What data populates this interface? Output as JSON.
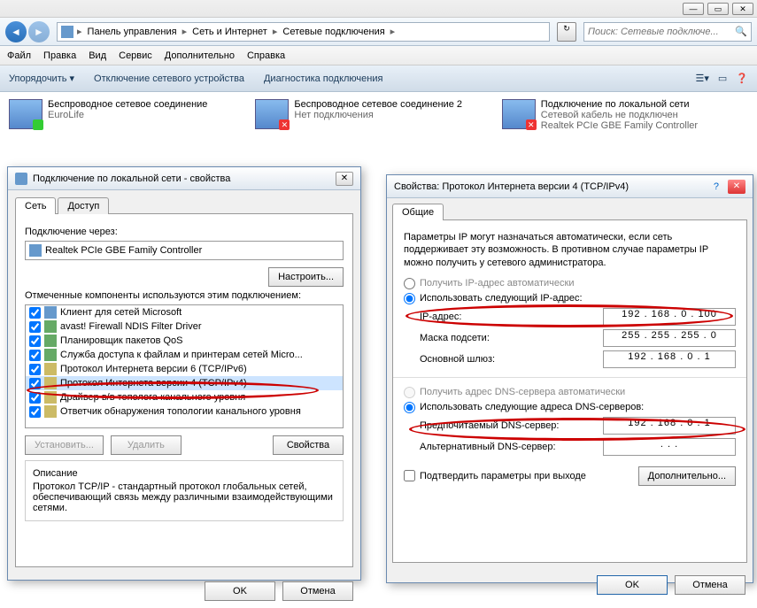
{
  "window": {
    "min": "—",
    "max": "▭",
    "close": "✕"
  },
  "breadcrumb": {
    "icon": "🖥",
    "items": [
      "Панель управления",
      "Сеть и Интернет",
      "Сетевые подключения"
    ],
    "sep": "▸"
  },
  "search": {
    "placeholder": "Поиск: Сетевые подключе..."
  },
  "menu": {
    "file": "Файл",
    "edit": "Правка",
    "view": "Вид",
    "service": "Сервис",
    "extra": "Дополнительно",
    "help": "Справка"
  },
  "toolbar": {
    "organize": "Упорядочить ▾",
    "disable": "Отключение сетевого устройства",
    "diag": "Диагностика подключения"
  },
  "adapters": [
    {
      "name": "Беспроводное сетевое соединение",
      "sub": "EuroLife",
      "third": ""
    },
    {
      "name": "Беспроводное сетевое соединение 2",
      "sub": "Нет подключения",
      "third": ""
    },
    {
      "name": "Подключение по локальной сети",
      "sub": "Сетевой кабель не подключен",
      "third": "Realtek PCIe GBE Family Controller"
    }
  ],
  "dlg1": {
    "title": "Подключение по локальной сети - свойства",
    "tab_net": "Сеть",
    "tab_access": "Доступ",
    "conn_via": "Подключение через:",
    "adapter": "Realtek PCIe GBE Family Controller",
    "configure": "Настроить...",
    "components_lbl": "Отмеченные компоненты используются этим подключением:",
    "components": [
      {
        "c": true,
        "t": "Клиент для сетей Microsoft"
      },
      {
        "c": true,
        "t": "avast! Firewall NDIS Filter Driver"
      },
      {
        "c": true,
        "t": "Планировщик пакетов QoS"
      },
      {
        "c": true,
        "t": "Служба доступа к файлам и принтерам сетей Micro..."
      },
      {
        "c": true,
        "t": "Протокол Интернета версии 6 (TCP/IPv6)"
      },
      {
        "c": true,
        "t": "Протокол Интернета версии 4 (TCP/IPv4)"
      },
      {
        "c": true,
        "t": "Драйвер в/в тополога канального уровня"
      },
      {
        "c": true,
        "t": "Ответчик обнаружения топологии канального уровня"
      }
    ],
    "install": "Установить...",
    "remove": "Удалить",
    "props": "Свойства",
    "desc_h": "Описание",
    "desc": "Протокол TCP/IP - стандартный протокол глобальных сетей, обеспечивающий связь между различными взаимодействующими сетями.",
    "ok": "OK",
    "cancel": "Отмена"
  },
  "dlg2": {
    "title": "Свойства: Протокол Интернета версии 4 (TCP/IPv4)",
    "tab_general": "Общие",
    "desc": "Параметры IP могут назначаться автоматически, если сеть поддерживает эту возможность. В противном случае параметры IP можно получить у сетевого администратора.",
    "r_auto_ip": "Получить IP-адрес автоматически",
    "r_use_ip": "Использовать следующий IP-адрес:",
    "ip_lbl": "IP-адрес:",
    "ip_val": "192 . 168 .  0  . 100",
    "mask_lbl": "Маска подсети:",
    "mask_val": "255 . 255 . 255 .  0",
    "gw_lbl": "Основной шлюз:",
    "gw_val": "192 . 168 .  0  .  1",
    "r_auto_dns": "Получить адрес DNS-сервера автоматически",
    "r_use_dns": "Использовать следующие адреса DNS-серверов:",
    "dns1_lbl": "Предпочитаемый DNS-сервер:",
    "dns1_val": "192 . 168 .  0  .  1",
    "dns2_lbl": "Альтернативный DNS-сервер:",
    "dns2_val": " .       .       .",
    "confirm": "Подтвердить параметры при выходе",
    "advanced": "Дополнительно...",
    "ok": "OK",
    "cancel": "Отмена"
  }
}
